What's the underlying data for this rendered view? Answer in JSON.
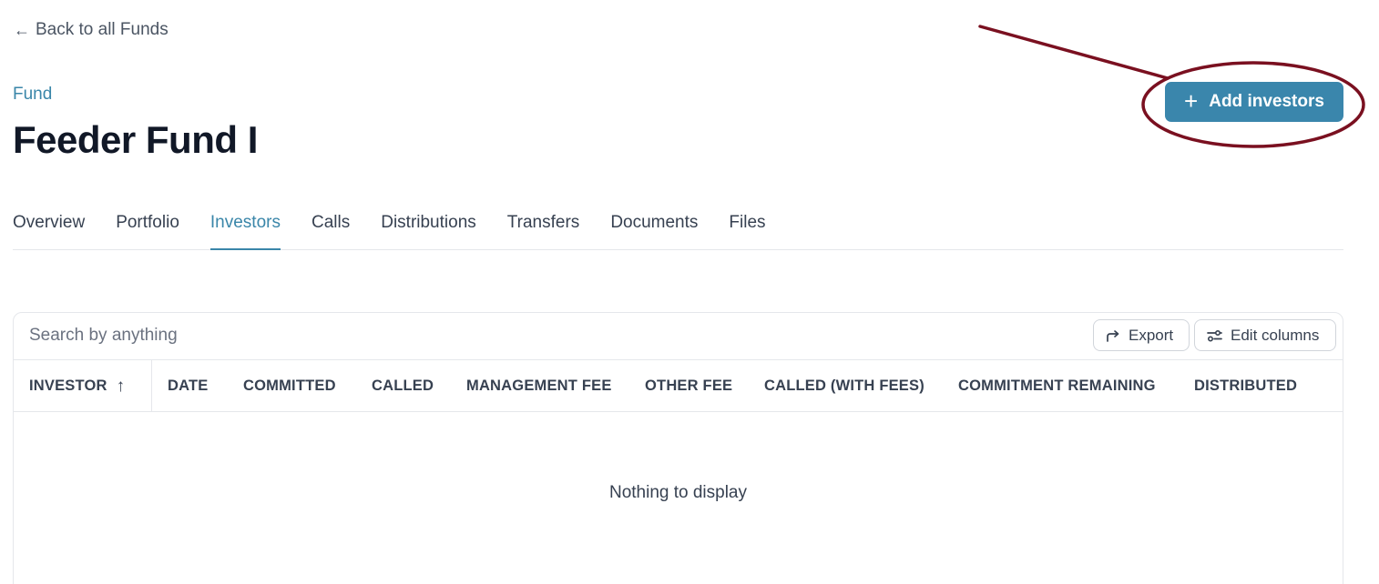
{
  "back_link": {
    "arrow": "←",
    "label": "Back to all Funds"
  },
  "header": {
    "eyebrow": "Fund",
    "title": "Feeder Fund I",
    "add_button": {
      "icon": "+",
      "label": "Add investors"
    }
  },
  "tabs": [
    {
      "label": "Overview",
      "active": false
    },
    {
      "label": "Portfolio",
      "active": false
    },
    {
      "label": "Investors",
      "active": true
    },
    {
      "label": "Calls",
      "active": false
    },
    {
      "label": "Distributions",
      "active": false
    },
    {
      "label": "Transfers",
      "active": false
    },
    {
      "label": "Documents",
      "active": false
    },
    {
      "label": "Files",
      "active": false
    }
  ],
  "table": {
    "search_placeholder": "Search by anything",
    "export_label": "Export",
    "edit_columns_label": "Edit columns",
    "sort_icon": "↑",
    "columns": [
      "INVESTOR",
      "DATE",
      "COMMITTED",
      "CALLED",
      "MANAGEMENT FEE",
      "OTHER FEE",
      "CALLED (WITH FEES)",
      "COMMITMENT REMAINING",
      "DISTRIBUTED"
    ],
    "empty_message": "Nothing to display"
  },
  "colors": {
    "accent": "#3a86a9",
    "button": "#3a86ac",
    "annotation": "#7a1020"
  }
}
